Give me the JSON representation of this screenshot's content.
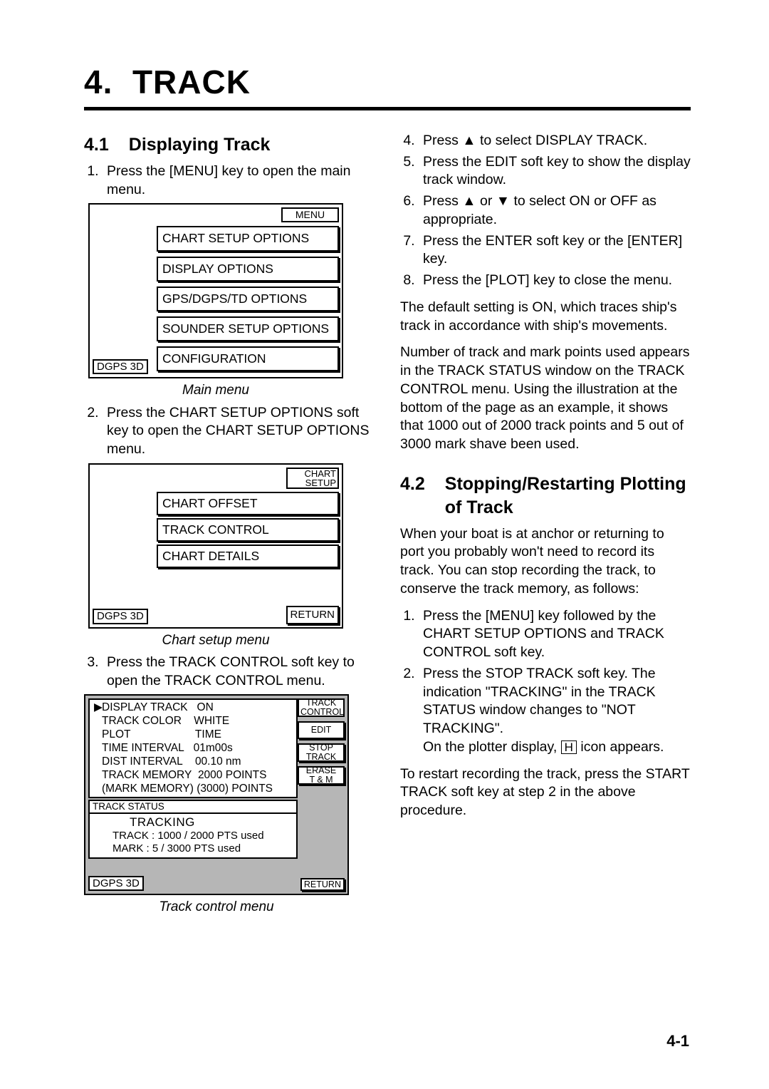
{
  "chapter": {
    "number": "4.",
    "title": "TRACK"
  },
  "s41": {
    "num": "4.1",
    "title": "Displaying Track",
    "steps_a": [
      "Press the [MENU] key to open the main menu."
    ],
    "steps_b": [
      "Press the CHART SETUP OPTIONS soft key to open the CHART SETUP OPTIONS menu."
    ],
    "steps_c": [
      "Press the TRACK CONTROL soft key to open the TRACK CONTROL menu."
    ],
    "steps_d": [
      "Press ▲ to select DISPLAY TRACK.",
      "Press the EDIT soft key to show the display track window.",
      "Press ▲ or ▼ to select ON or OFF as appropriate.",
      "Press the ENTER soft key or the [ENTER] key.",
      "Press the [PLOT] key to close the menu."
    ],
    "para1": "The default setting is ON, which traces ship's track in accordance with ship's movements.",
    "para2": "Number of track and mark points used appears in the TRACK STATUS window on the TRACK CONTROL menu. Using the illustration at the bottom of the page as an example, it shows that 1000 out of 2000 track points and 5 out of 3000 mark shave been used."
  },
  "s42": {
    "num": "4.2",
    "title": "Stopping/Restarting Plotting of Track",
    "intro": "When your boat is at anchor or returning to port you probably won't need to record its track. You can stop recording the track, to conserve the track memory, as follows:",
    "steps": [
      "Press the [MENU] key followed by the CHART SETUP OPTIONS and TRACK CONTROL soft key.",
      "Press the STOP TRACK soft key. The indication \"TRACKING\" in the TRACK STATUS window changes to \"NOT TRACKING\"."
    ],
    "tail1_a": "On the plotter display, ",
    "tail1_h": "H",
    "tail1_b": " icon appears.",
    "para2": "To restart recording the track, press the START TRACK soft key at step 2 in the above procedure."
  },
  "fig1": {
    "header": "MENU",
    "items": [
      "CHART SETUP OPTIONS",
      "DISPLAY OPTIONS",
      "GPS/DGPS/TD OPTIONS",
      "SOUNDER SETUP OPTIONS",
      "CONFIGURATION"
    ],
    "status": "DGPS 3D",
    "caption": "Main menu"
  },
  "fig2": {
    "header1": "CHART",
    "header2": "SETUP",
    "items": [
      "CHART OFFSET",
      "TRACK CONTROL",
      "CHART DETAILS"
    ],
    "status": "DGPS 3D",
    "return": "RETURN",
    "caption": "Chart setup menu"
  },
  "fig3": {
    "settings": [
      {
        "sel": true,
        "k": "DISPLAY TRACK",
        "v": "ON"
      },
      {
        "sel": false,
        "k": "TRACK COLOR",
        "v": "WHITE"
      },
      {
        "sel": false,
        "k": "PLOT",
        "v": "TIME"
      },
      {
        "sel": false,
        "k": "TIME INTERVAL",
        "v": "01m00s"
      },
      {
        "sel": false,
        "k": "DIST INTERVAL",
        "v": "00.10 nm"
      },
      {
        "sel": false,
        "k": "TRACK MEMORY",
        "v": "2000 POINTS"
      },
      {
        "sel": false,
        "k": "(MARK MEMORY)",
        "v": "(3000) POINTS"
      }
    ],
    "softkeys": {
      "hdr1": "TRACK",
      "hdr2": "CONTROL",
      "edit": "EDIT",
      "stop1": "STOP",
      "stop2": "TRACK",
      "erase1": "ERASE",
      "erase2": "T & M",
      "return": "RETURN"
    },
    "status_hdr": "TRACK STATUS",
    "status_title": "TRACKING",
    "status_line1": "TRACK :  1000 / 2000 PTS used",
    "status_line2": "MARK   :        5 / 3000 PTS used",
    "status": "DGPS 3D",
    "caption": "Track control menu"
  },
  "page_number": "4-1"
}
